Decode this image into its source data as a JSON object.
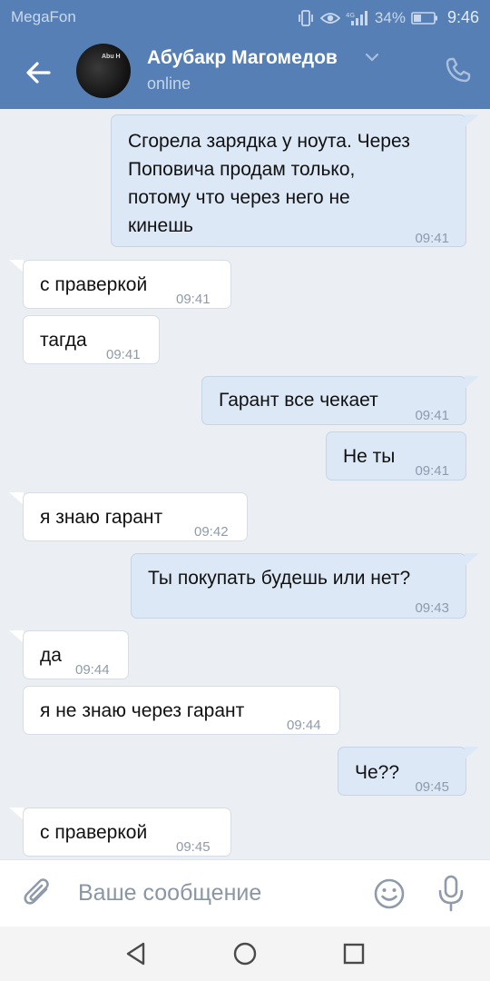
{
  "status_bar": {
    "carrier": "MegaFon",
    "battery": "34%",
    "time": "9:46"
  },
  "header": {
    "contact_name": "Абубакр Магомедов",
    "status": "online",
    "avatar_text": "Abu H"
  },
  "messages": [
    {
      "direction": "out",
      "lines": [
        "Сгорела зарядка у ноута. Через",
        "Поповича продам только,",
        "потому что через него не",
        "кинешь"
      ],
      "time": "09:41"
    },
    {
      "direction": "in",
      "lines": [
        "с праверкой"
      ],
      "time": "09:41"
    },
    {
      "direction": "in",
      "lines": [
        "тагда"
      ],
      "time": "09:41"
    },
    {
      "direction": "out",
      "lines": [
        "Гарант все чекает"
      ],
      "time": "09:41"
    },
    {
      "direction": "out",
      "lines": [
        "Не ты"
      ],
      "time": "09:41"
    },
    {
      "direction": "in",
      "lines": [
        "я знаю гарант"
      ],
      "time": "09:42"
    },
    {
      "direction": "out",
      "lines": [
        "Ты покупать будешь или нет?"
      ],
      "time": "09:43"
    },
    {
      "direction": "in",
      "lines": [
        "да"
      ],
      "time": "09:44"
    },
    {
      "direction": "in",
      "lines": [
        "я не знаю через гарант"
      ],
      "time": "09:44"
    },
    {
      "direction": "out",
      "lines": [
        "Че??"
      ],
      "time": "09:45"
    },
    {
      "direction": "in",
      "lines": [
        "с праверкой"
      ],
      "time": "09:45"
    }
  ],
  "composer": {
    "placeholder": "Ваше сообщение"
  },
  "colors": {
    "header": "#5680b5",
    "outgoing_bubble": "#dce8f6",
    "incoming_bubble": "#ffffff",
    "chat_background": "#ebeff4"
  },
  "icons": {
    "back": "arrow-left-icon",
    "call": "phone-icon",
    "attach": "paperclip-icon",
    "emoji": "smiley-icon",
    "mic": "microphone-icon"
  }
}
